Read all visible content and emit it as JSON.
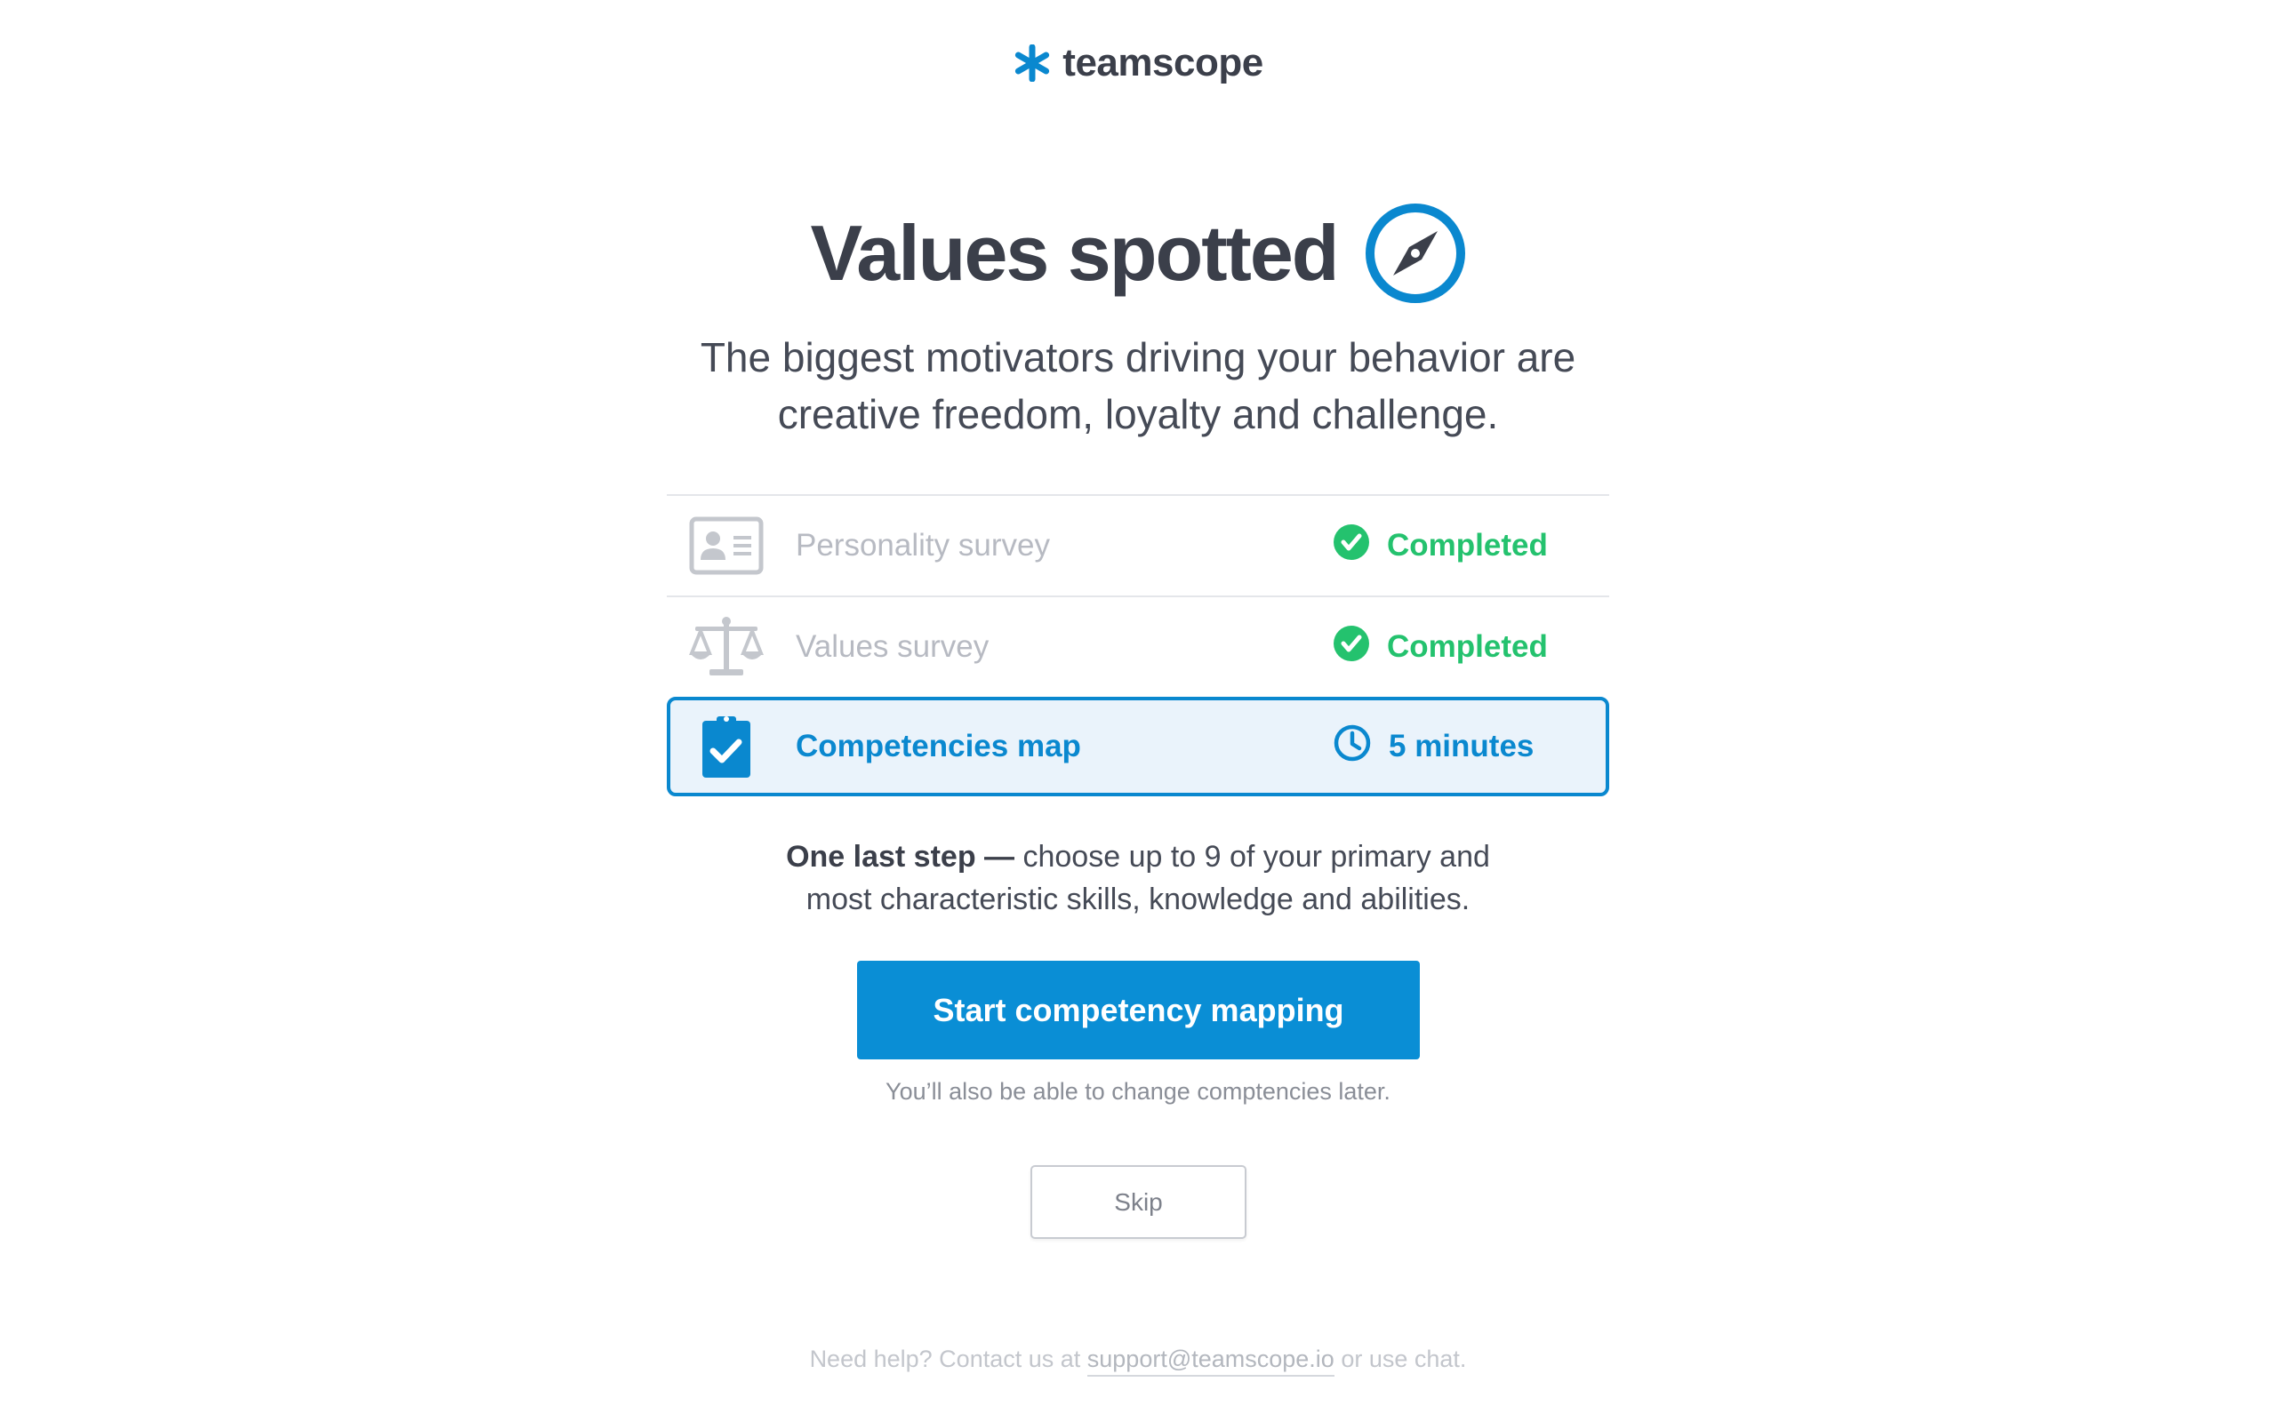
{
  "logo": {
    "icon": "asterisk-logo-icon",
    "text": "teamscope",
    "color": "#0a88cf"
  },
  "heading": {
    "title": "Values spotted",
    "icon": "compass-icon"
  },
  "subtitle": {
    "line1": "The biggest motivators driving your behavior are",
    "line2": "creative freedom, loyalty and challenge."
  },
  "steps": [
    {
      "label": "Personality survey",
      "icon": "id-card-icon",
      "status": "Completed",
      "status_icon": "check-circle-icon",
      "state": "completed"
    },
    {
      "label": "Values survey",
      "icon": "scales-icon",
      "status": "Completed",
      "status_icon": "check-circle-icon",
      "state": "completed"
    },
    {
      "label": "Competencies map",
      "icon": "clipboard-check-icon",
      "status": "5 minutes",
      "status_icon": "clock-icon",
      "state": "active"
    }
  ],
  "note": {
    "bold": "One last step —",
    "line1_rest": " choose up to 9 of your primary and",
    "line2": "most characteristic skills, knowledge and abilities."
  },
  "primary_button": {
    "label": "Start competency mapping"
  },
  "helper_text": "You’ll also be able to change comptencies later.",
  "skip_button": {
    "label": "Skip"
  },
  "footer": {
    "prefix": "Need help? Contact us at ",
    "email": "support@teamscope.io",
    "suffix": " or use chat."
  },
  "colors": {
    "accent": "#0a88cf",
    "success": "#24c26e",
    "text": "#3b3f4a",
    "muted": "#b7bac2"
  }
}
